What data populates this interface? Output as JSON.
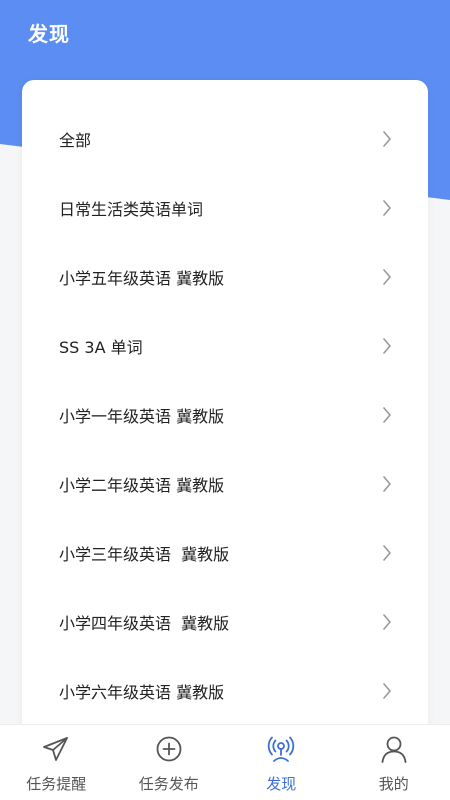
{
  "header": {
    "title": "发现"
  },
  "list": {
    "items": [
      {
        "label": "全部"
      },
      {
        "label": "日常生活类英语单词"
      },
      {
        "label": "小学五年级英语 冀教版"
      },
      {
        "label": "SS 3A 单词"
      },
      {
        "label": "小学一年级英语 冀教版"
      },
      {
        "label": "小学二年级英语 冀教版"
      },
      {
        "label": "小学三年级英语  冀教版"
      },
      {
        "label": "小学四年级英语  冀教版"
      },
      {
        "label": "小学六年级英语 冀教版"
      }
    ],
    "chevron_icon": "chevron-right-icon"
  },
  "tabbar": {
    "tabs": [
      {
        "label": "任务提醒",
        "icon": "paper-plane-icon",
        "active": false
      },
      {
        "label": "任务发布",
        "icon": "plus-circle-icon",
        "active": false
      },
      {
        "label": "发现",
        "icon": "broadcast-icon",
        "active": true
      },
      {
        "label": "我的",
        "icon": "user-icon",
        "active": false
      }
    ]
  },
  "colors": {
    "header_blue": "#5b8df3",
    "active_tab": "#3d6fd6",
    "inactive_tab": "#555555"
  }
}
